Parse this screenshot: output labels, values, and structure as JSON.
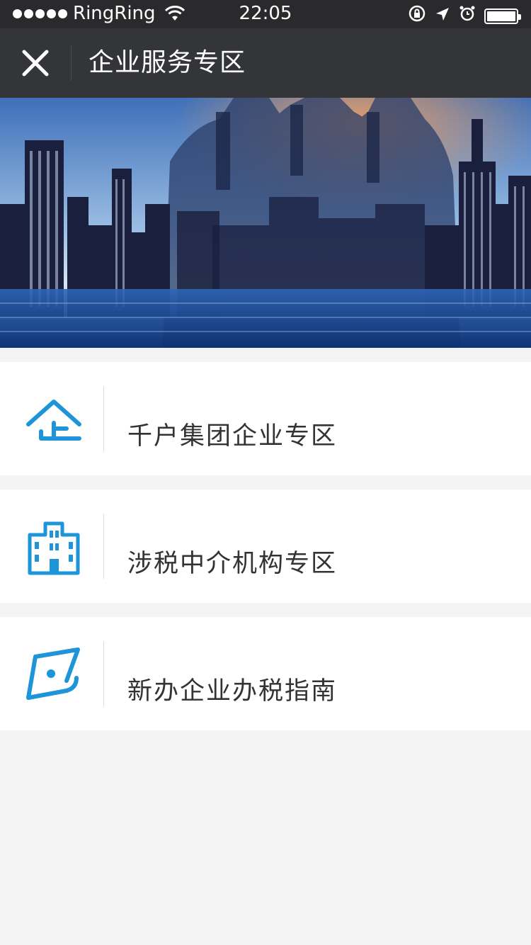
{
  "status_bar": {
    "carrier": "RingRing",
    "time": "22:05",
    "battery_level": 1.0
  },
  "nav": {
    "title": "企业服务专区",
    "close_icon": "close-icon"
  },
  "banner": {
    "image": "city-skyline-business-people-banner"
  },
  "menu": [
    {
      "label": "千户集团企业专区",
      "icon": "enterprise-house-icon"
    },
    {
      "label": "涉税中介机构专区",
      "icon": "office-building-icon"
    },
    {
      "label": "新办企业办税指南",
      "icon": "compass-guide-icon"
    }
  ],
  "colors": {
    "accent": "#1e95d8",
    "nav_bg": "#343538",
    "status_bg": "#2a2a2c",
    "page_bg": "#f3f3f3"
  }
}
